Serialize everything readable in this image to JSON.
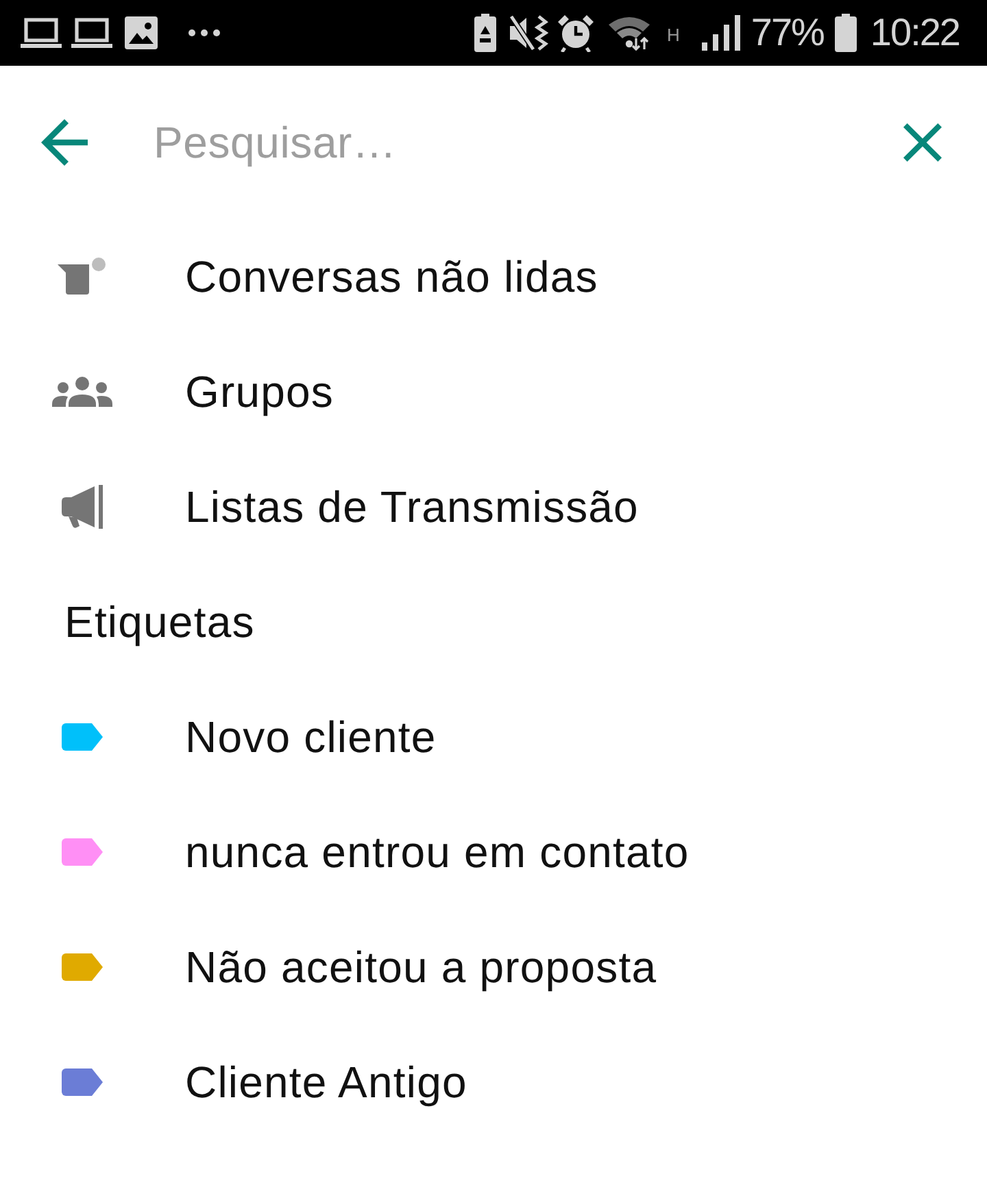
{
  "status_bar": {
    "network_type": "H",
    "battery": "77%",
    "time": "10:22"
  },
  "search": {
    "placeholder": "Pesquisar…"
  },
  "filters": [
    {
      "kind": "unread",
      "label": "Conversas não lidas"
    },
    {
      "kind": "groups",
      "label": "Grupos"
    },
    {
      "kind": "broadcast",
      "label": "Listas de Transmissão"
    }
  ],
  "labels": {
    "title": "Etiquetas",
    "items": [
      {
        "name": "Novo cliente",
        "color": "#00c0fa"
      },
      {
        "name": "nunca entrou em contato",
        "color": "#ff8ff5"
      },
      {
        "name": "Não aceitou a proposta",
        "color": "#e0aa00"
      },
      {
        "name": "Cliente Antigo",
        "color": "#6b7dd6"
      }
    ]
  }
}
